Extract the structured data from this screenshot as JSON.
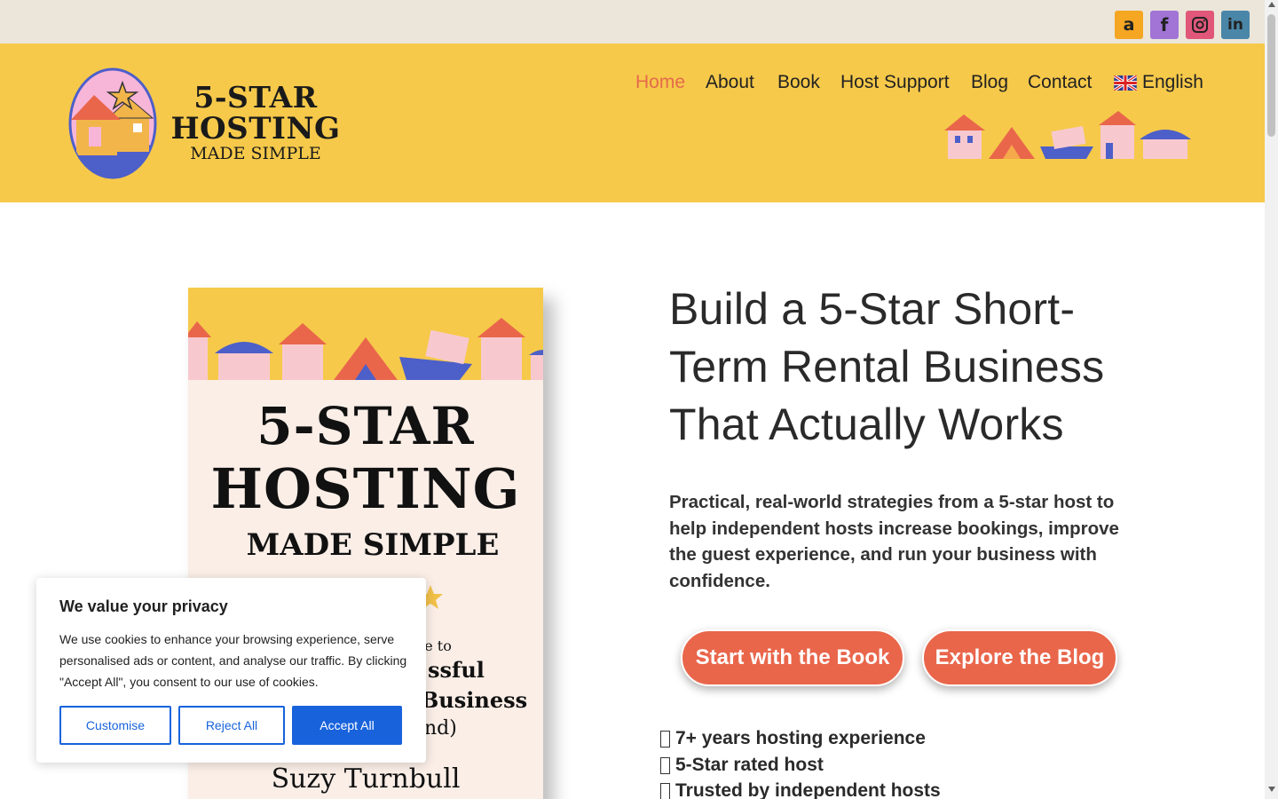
{
  "social": [
    {
      "name": "amazon",
      "glyph": "a",
      "color": "#f5a623"
    },
    {
      "name": "facebook",
      "glyph": "f",
      "color": "#a174d6"
    },
    {
      "name": "instagram",
      "glyph": "",
      "color": "#e0577a"
    },
    {
      "name": "linkedin",
      "glyph": "in",
      "color": "#4a86a8"
    }
  ],
  "logo": {
    "line1": "5-STAR",
    "line2": "HOSTING",
    "line3": "MADE SIMPLE"
  },
  "nav": {
    "items": [
      "Home",
      "About",
      "Book",
      "Host Support",
      "Blog",
      "Contact"
    ],
    "active": "Home",
    "language": "English"
  },
  "book": {
    "title1": "5-STAR",
    "title2": "HOSTING",
    "title3": "MADE SIMPLE",
    "guide_partial": "de to",
    "line_a": "ssful",
    "line_b": "Business",
    "line_c": "nd)",
    "author": "Suzy Turnbull"
  },
  "hero": {
    "heading": "Build a 5-Star Short-Term Rental Business That Actually Works",
    "body": "Practical, real-world strategies from a 5-star host to help independent hosts increase bookings, improve the guest experience, and run your business with confidence.",
    "primary_cta": "Start with the Book",
    "secondary_cta": "Explore the Blog",
    "checks": [
      "7+ years hosting experience",
      "5-Star rated host",
      "Trusted by independent hosts"
    ]
  },
  "cookie": {
    "title": "We value your privacy",
    "text": "We use cookies to enhance your browsing experience, serve personalised ads or content, and analyse our traffic. By clicking \"Accept All\", you consent to our use of cookies.",
    "customise": "Customise",
    "reject": "Reject All",
    "accept": "Accept All"
  },
  "colors": {
    "header_bg": "#f6c94a",
    "accent": "#e9664b",
    "cookie_blue": "#1863dc",
    "topbar_bg": "#ebe6d9"
  }
}
